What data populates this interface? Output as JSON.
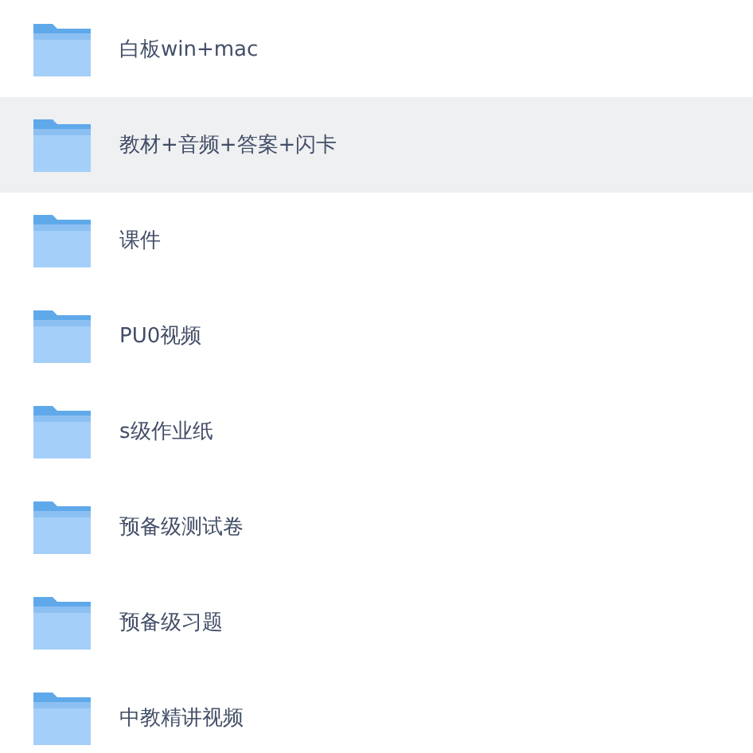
{
  "files": [
    {
      "name": "白板win+mac",
      "selected": false
    },
    {
      "name": "教材+音频+答案+闪卡",
      "selected": true
    },
    {
      "name": "课件",
      "selected": false
    },
    {
      "name": "PU0视频",
      "selected": false
    },
    {
      "name": "s级作业纸",
      "selected": false
    },
    {
      "name": "预备级测试卷",
      "selected": false
    },
    {
      "name": "预备级习题",
      "selected": false
    },
    {
      "name": "中教精讲视频",
      "selected": false
    }
  ]
}
